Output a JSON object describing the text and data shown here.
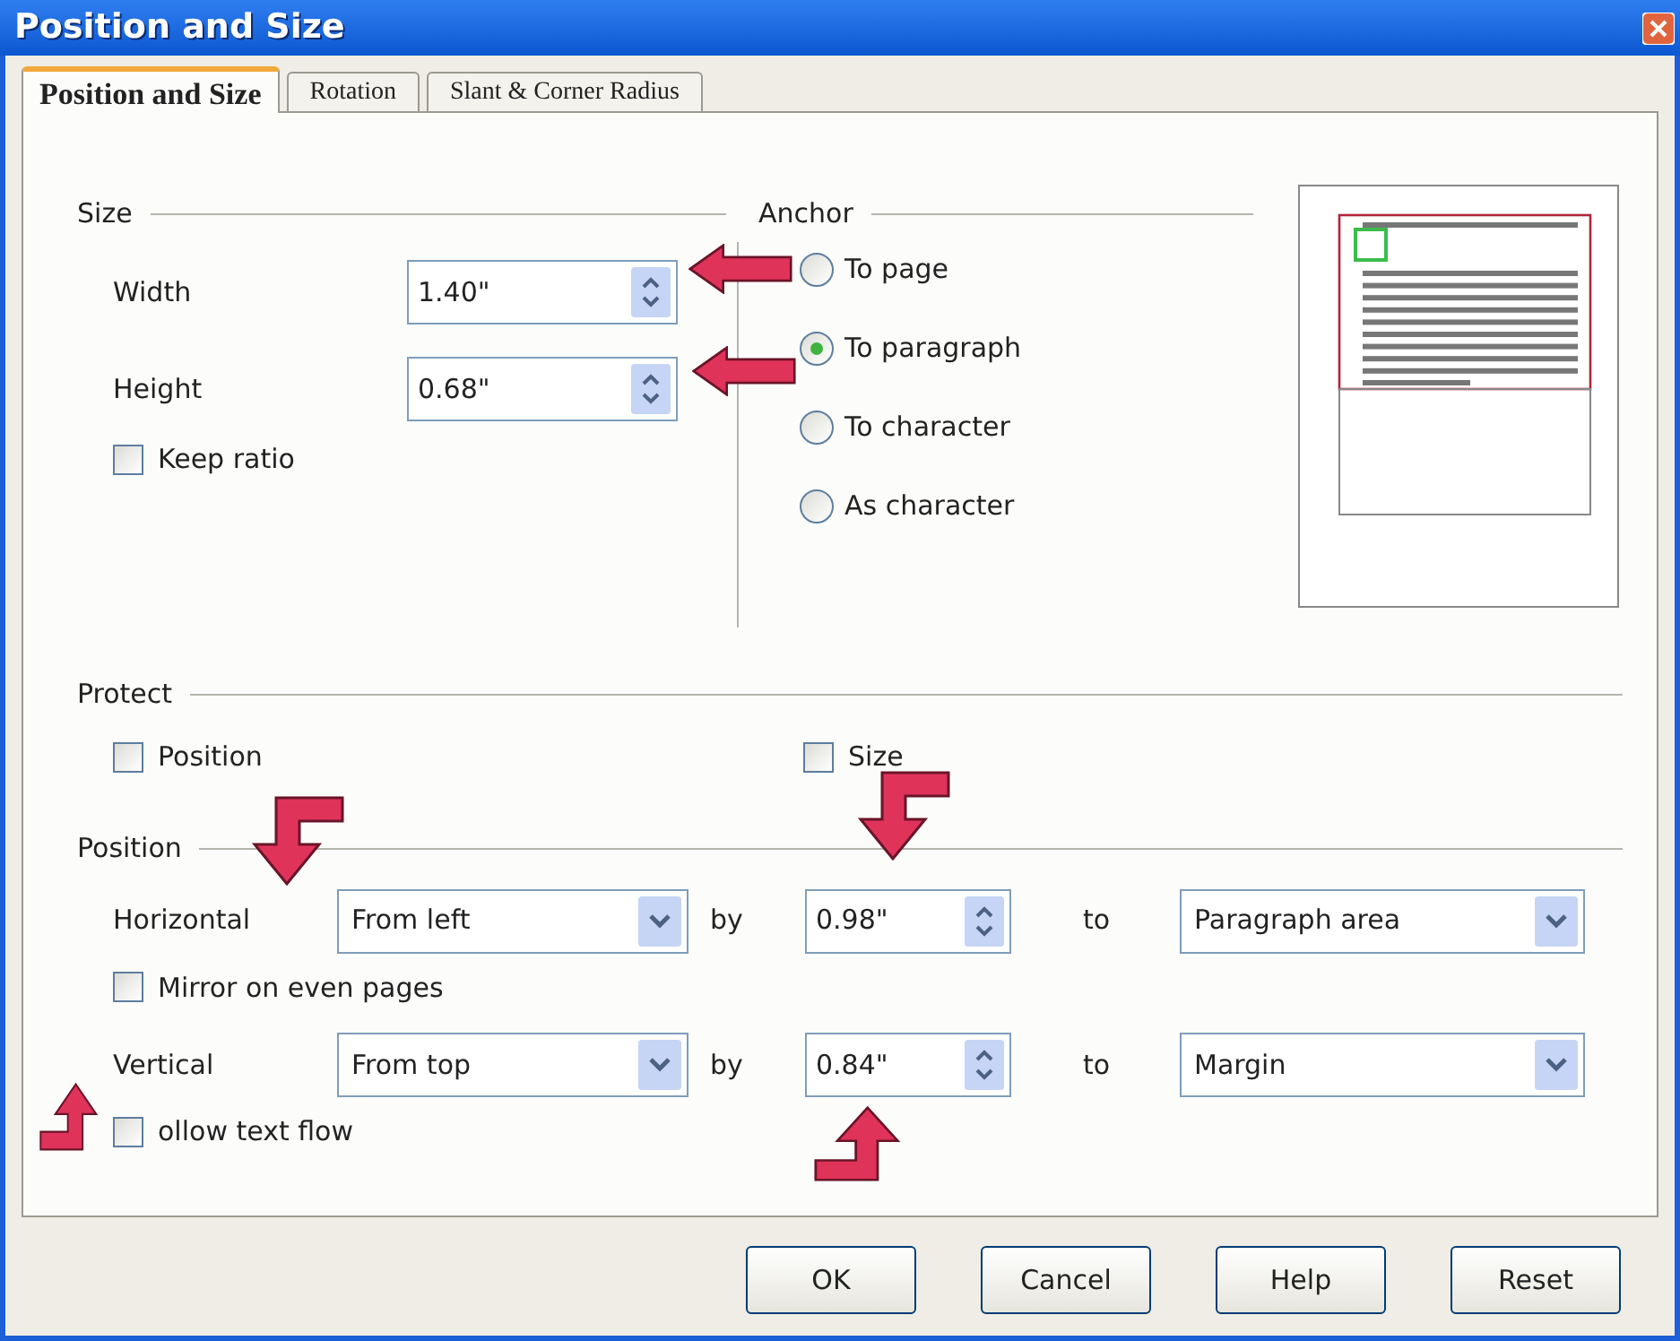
{
  "window": {
    "title": "Position and Size"
  },
  "tabs": [
    {
      "label": "Position and Size",
      "selected": true
    },
    {
      "label": "Rotation",
      "selected": false
    },
    {
      "label": "Slant & Corner Radius",
      "selected": false
    }
  ],
  "size": {
    "heading": "Size",
    "fields": [
      {
        "label": "Width",
        "value": "1.40\""
      },
      {
        "label": "Height",
        "value": "0.68\""
      }
    ],
    "keep_ratio": {
      "label": "Keep ratio",
      "checked": false
    }
  },
  "anchor": {
    "heading": "Anchor",
    "options": [
      {
        "label": "To page",
        "selected": false
      },
      {
        "label": "To paragraph",
        "selected": true
      },
      {
        "label": "To character",
        "selected": false
      },
      {
        "label": "As character",
        "selected": false
      }
    ]
  },
  "protect": {
    "heading": "Protect",
    "options": [
      {
        "label": "Position",
        "checked": false
      },
      {
        "label": "Size",
        "checked": false
      }
    ]
  },
  "position": {
    "heading": "Position",
    "rows": [
      {
        "label": "Horizontal",
        "from": "From left",
        "by_label": "by",
        "by": "0.98\"",
        "to_label": "to",
        "to": "Paragraph area",
        "option": {
          "label": "Mirror on even pages",
          "checked": false
        }
      },
      {
        "label": "Vertical",
        "from": "From top",
        "by_label": "by",
        "by": "0.84\"",
        "to_label": "to",
        "to": "Margin",
        "option": {
          "label": "ollow text flow",
          "checked": false
        }
      }
    ]
  },
  "buttons": [
    {
      "label": "OK"
    },
    {
      "label": "Cancel"
    },
    {
      "label": "Help"
    },
    {
      "label": "Reset"
    }
  ]
}
